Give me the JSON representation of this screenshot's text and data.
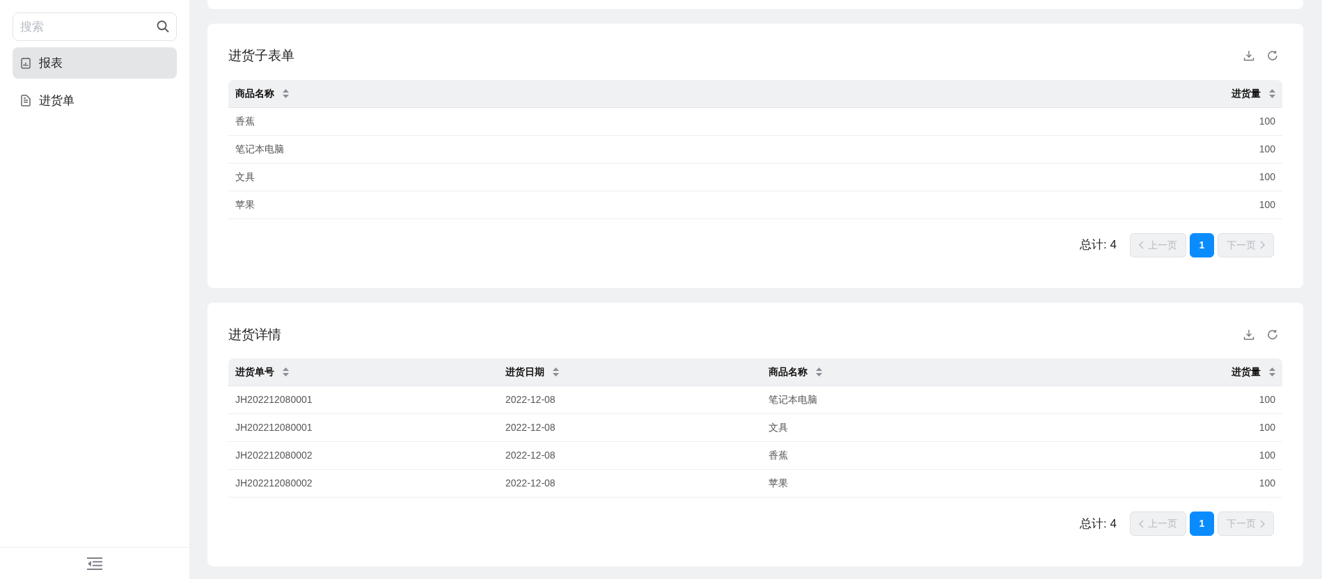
{
  "sidebar": {
    "search": {
      "placeholder": "搜索"
    },
    "items": [
      {
        "label": "报表",
        "kind": "report",
        "selected": true
      },
      {
        "label": "进货单",
        "kind": "document",
        "selected": false
      }
    ]
  },
  "panels": [
    {
      "title": "进货子表单",
      "columns": [
        {
          "label": "商品名称",
          "kind": "text"
        },
        {
          "label": "进货量",
          "kind": "number"
        }
      ],
      "rows": [
        [
          "香蕉",
          "100"
        ],
        [
          "笔记本电脑",
          "100"
        ],
        [
          "文具",
          "100"
        ],
        [
          "苹果",
          "100"
        ]
      ],
      "total": "总计: 4",
      "prev": {
        "label": "上一页",
        "disabled": true
      },
      "pages": [
        {
          "label": "1",
          "selected": true
        }
      ],
      "next": {
        "label": "下一页",
        "disabled": true
      }
    },
    {
      "title": "进货详情",
      "columns": [
        {
          "label": "进货单号",
          "kind": "text"
        },
        {
          "label": "进货日期",
          "kind": "text"
        },
        {
          "label": "商品名称",
          "kind": "text"
        },
        {
          "label": "进货量",
          "kind": "number"
        }
      ],
      "rows": [
        [
          "JH202212080001",
          "2022-12-08",
          "笔记本电脑",
          "100"
        ],
        [
          "JH202212080001",
          "2022-12-08",
          "文具",
          "100"
        ],
        [
          "JH202212080002",
          "2022-12-08",
          "香蕉",
          "100"
        ],
        [
          "JH202212080002",
          "2022-12-08",
          "苹果",
          "100"
        ]
      ],
      "total": "总计: 4",
      "prev": {
        "label": "上一页",
        "disabled": true
      },
      "pages": [
        {
          "label": "1",
          "selected": true
        }
      ],
      "next": {
        "label": "下一页",
        "disabled": true
      }
    }
  ]
}
